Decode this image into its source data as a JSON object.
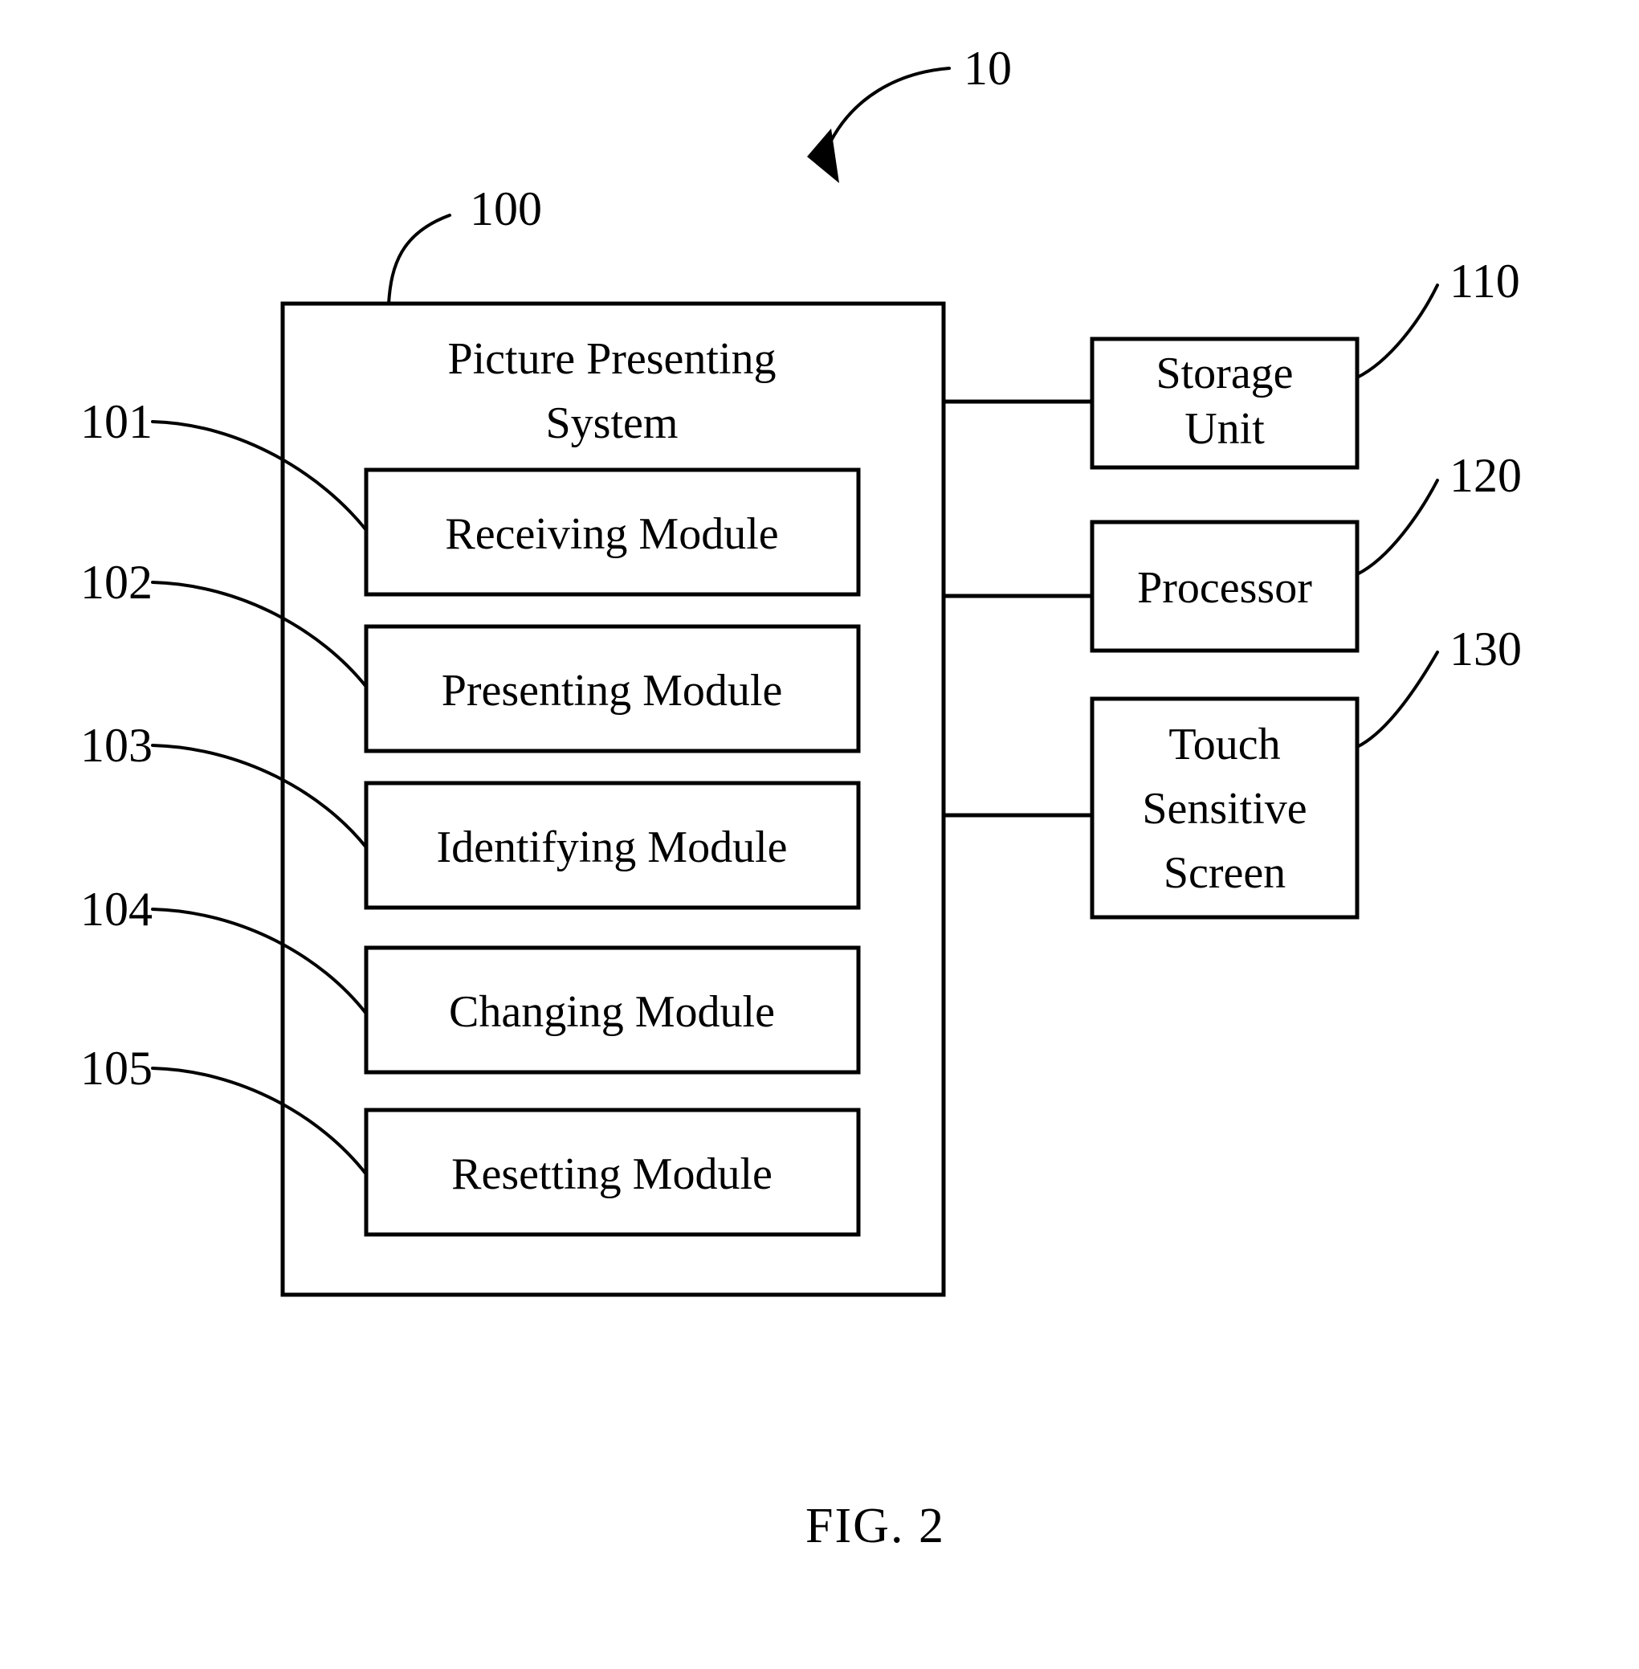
{
  "figure": {
    "caption": "FIG. 2",
    "overall_ref": "10"
  },
  "system": {
    "ref": "100",
    "title_line1": "Picture Presenting",
    "title_line2": "System",
    "modules": [
      {
        "ref": "101",
        "label": "Receiving Module"
      },
      {
        "ref": "102",
        "label": "Presenting Module"
      },
      {
        "ref": "103",
        "label": "Identifying Module"
      },
      {
        "ref": "104",
        "label": "Changing Module"
      },
      {
        "ref": "105",
        "label": "Resetting Module"
      }
    ]
  },
  "peripherals": [
    {
      "ref": "110",
      "label_line1": "Storage",
      "label_line2": "Unit",
      "label_line3": ""
    },
    {
      "ref": "120",
      "label_line1": "Processor",
      "label_line2": "",
      "label_line3": ""
    },
    {
      "ref": "130",
      "label_line1": "Touch",
      "label_line2": "Sensitive",
      "label_line3": "Screen"
    }
  ],
  "colors": {
    "stroke": "#000000",
    "background": "#ffffff"
  }
}
